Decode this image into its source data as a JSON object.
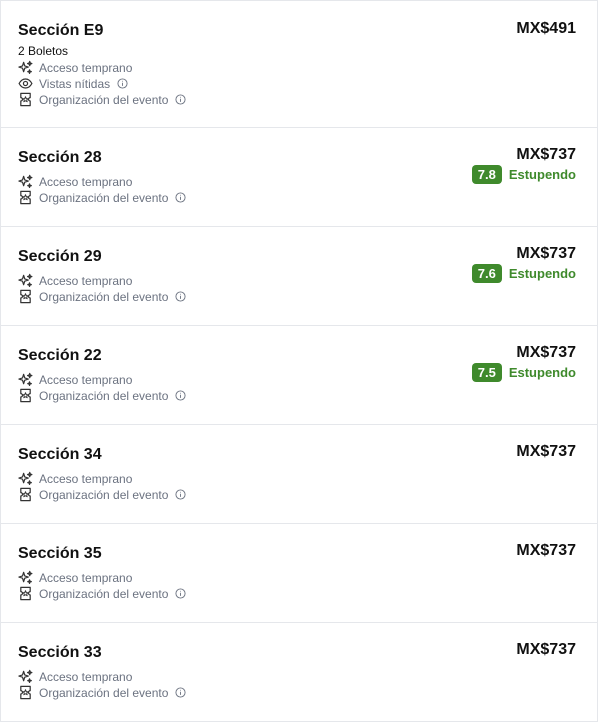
{
  "sections": [
    {
      "title": "Sección E9",
      "subtitle": "2 Boletos",
      "price": "MX$491",
      "features": [
        {
          "icon": "sparkle-icon",
          "label": "Acceso temprano",
          "info": false
        },
        {
          "icon": "eye-icon",
          "label": "Vistas nítidas",
          "info": true
        },
        {
          "icon": "ticket-icon",
          "label": "Organización del evento",
          "info": true
        }
      ]
    },
    {
      "title": "Sección 28",
      "price": "MX$737",
      "rating": {
        "score": "7.8",
        "label": "Estupendo"
      },
      "features": [
        {
          "icon": "sparkle-icon",
          "label": "Acceso temprano",
          "info": false
        },
        {
          "icon": "ticket-icon",
          "label": "Organización del evento",
          "info": true
        }
      ]
    },
    {
      "title": "Sección 29",
      "price": "MX$737",
      "rating": {
        "score": "7.6",
        "label": "Estupendo"
      },
      "features": [
        {
          "icon": "sparkle-icon",
          "label": "Acceso temprano",
          "info": false
        },
        {
          "icon": "ticket-icon",
          "label": "Organización del evento",
          "info": true
        }
      ]
    },
    {
      "title": "Sección 22",
      "price": "MX$737",
      "rating": {
        "score": "7.5",
        "label": "Estupendo"
      },
      "features": [
        {
          "icon": "sparkle-icon",
          "label": "Acceso temprano",
          "info": false
        },
        {
          "icon": "ticket-icon",
          "label": "Organización del evento",
          "info": true
        }
      ]
    },
    {
      "title": "Sección 34",
      "price": "MX$737",
      "features": [
        {
          "icon": "sparkle-icon",
          "label": "Acceso temprano",
          "info": false
        },
        {
          "icon": "ticket-icon",
          "label": "Organización del evento",
          "info": true
        }
      ]
    },
    {
      "title": "Sección 35",
      "price": "MX$737",
      "features": [
        {
          "icon": "sparkle-icon",
          "label": "Acceso temprano",
          "info": false
        },
        {
          "icon": "ticket-icon",
          "label": "Organización del evento",
          "info": true
        }
      ]
    },
    {
      "title": "Sección 33",
      "price": "MX$737",
      "features": [
        {
          "icon": "sparkle-icon",
          "label": "Acceso temprano",
          "info": false
        },
        {
          "icon": "ticket-icon",
          "label": "Organización del evento",
          "info": true
        }
      ]
    }
  ],
  "colors": {
    "rating_green": "#3f8a2c",
    "muted_text": "#6b7280",
    "divider": "#e5e7eb"
  }
}
